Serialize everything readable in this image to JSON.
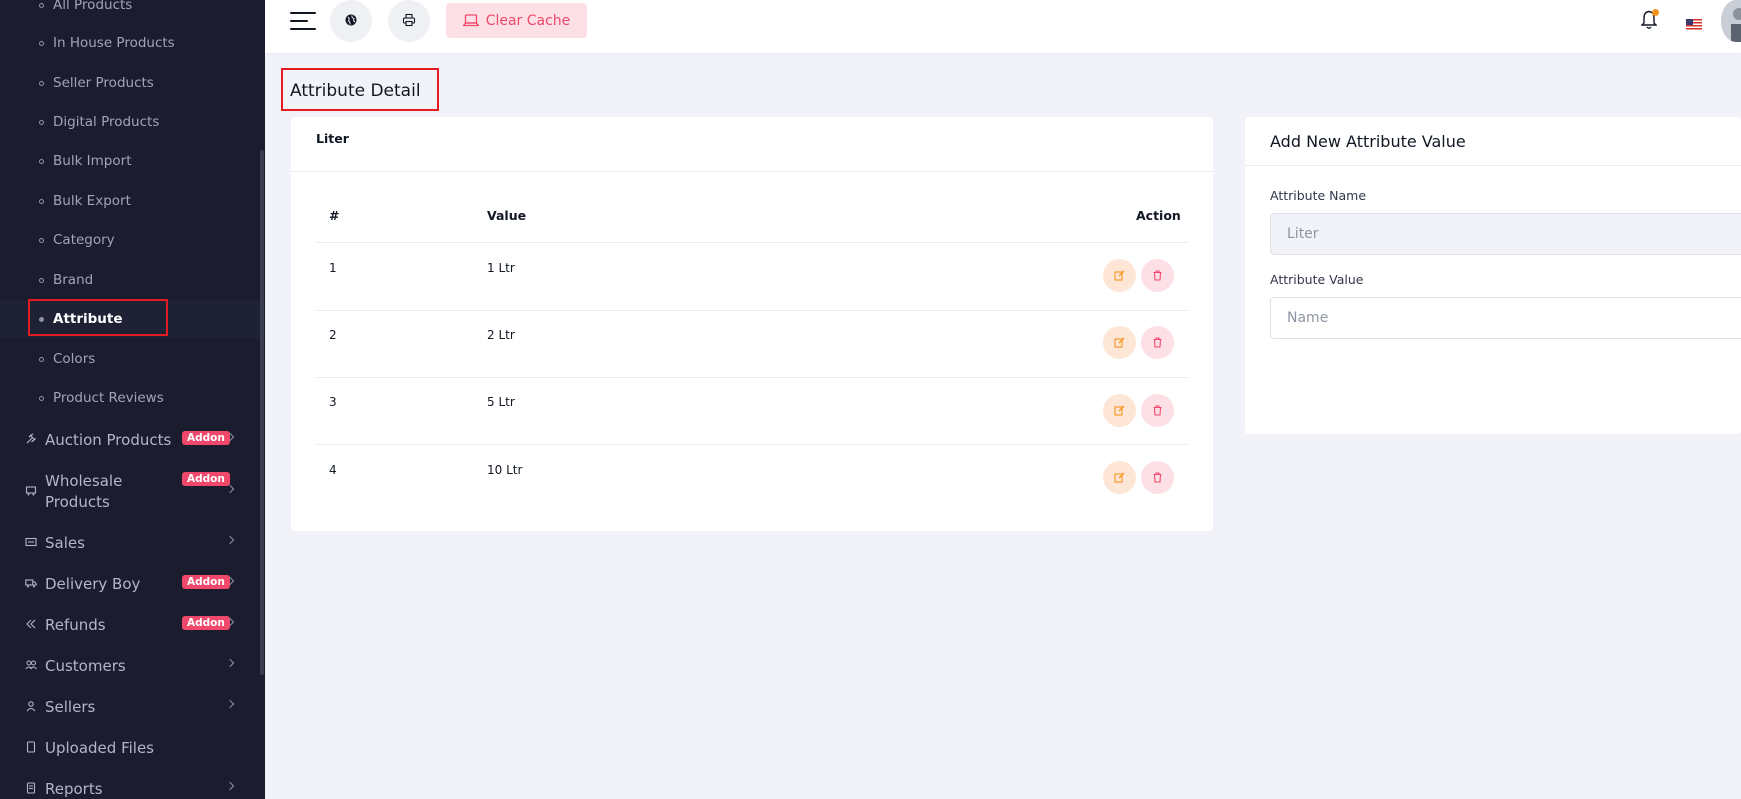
{
  "sidebar": {
    "sub_items": [
      "All Products",
      "In House Products",
      "Seller Products",
      "Digital Products",
      "Bulk Import",
      "Bulk Export",
      "Category",
      "Brand",
      "Attribute",
      "Colors",
      "Product Reviews"
    ],
    "main_items": [
      {
        "label": "Auction Products",
        "badge": "Addon",
        "icon": "gavel-icon"
      },
      {
        "label": "Wholesale Products",
        "badge": "Addon",
        "icon": "wholesale-cart-icon"
      },
      {
        "label": "Sales",
        "badge": "",
        "icon": "sales-icon"
      },
      {
        "label": "Delivery Boy",
        "badge": "Addon",
        "icon": "truck-icon"
      },
      {
        "label": "Refunds",
        "badge": "Addon",
        "icon": "refund-icon"
      },
      {
        "label": "Customers",
        "badge": "",
        "icon": "customers-icon"
      },
      {
        "label": "Sellers",
        "badge": "",
        "icon": "user-icon"
      },
      {
        "label": "Uploaded Files",
        "badge": "",
        "icon": "file-icon"
      },
      {
        "label": "Reports",
        "badge": "",
        "icon": "report-icon"
      }
    ]
  },
  "topbar": {
    "clear_cache_label": "Clear Cache"
  },
  "page": {
    "title": "Attribute Detail"
  },
  "values_card": {
    "attribute": "Liter",
    "headers": {
      "num": "#",
      "value": "Value",
      "action": "Action"
    },
    "rows": [
      {
        "num": "1",
        "value": "1 Ltr"
      },
      {
        "num": "2",
        "value": "2 Ltr"
      },
      {
        "num": "3",
        "value": "5 Ltr"
      },
      {
        "num": "4",
        "value": "10 Ltr"
      }
    ]
  },
  "form": {
    "title": "Add New Attribute Value",
    "name_label": "Attribute Name",
    "name_placeholder": "Liter",
    "value_label": "Attribute Value",
    "value_placeholder": "Name"
  },
  "colors": {
    "sidebar_bg": "#1b1d2f",
    "accent_pink": "#ef486a",
    "highlight_red": "#e31b23"
  }
}
